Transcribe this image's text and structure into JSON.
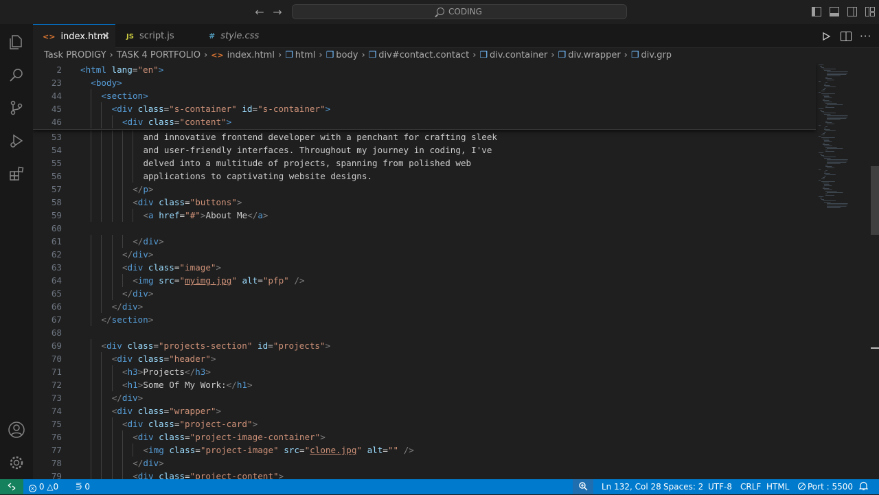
{
  "titlebar": {
    "search_text": "CODING"
  },
  "tabs": [
    {
      "label": "index.html",
      "icon": "html-file-icon",
      "active": true
    },
    {
      "label": "script.js",
      "icon": "js-file-icon",
      "active": false
    },
    {
      "label": "style.css",
      "icon": "css-file-icon",
      "active": false
    }
  ],
  "tab_icons": {
    "html": "<>",
    "js": "JS",
    "css": "#"
  },
  "breadcrumb": [
    "Task PRODIGY",
    "TASK 4 PORTFOLIO",
    "index.html",
    "html",
    "body",
    "div#contact.contact",
    "div.container",
    "div.wrapper",
    "div.grp"
  ],
  "sticky_lines": [
    {
      "n": "2",
      "indent": 0,
      "tokens": [
        [
          "tg",
          "<html "
        ],
        [
          "at",
          "lang"
        ],
        [
          "tx",
          "="
        ],
        [
          "st",
          "\"en\""
        ],
        [
          "tg",
          ">"
        ]
      ]
    },
    {
      "n": "23",
      "indent": 1,
      "tokens": [
        [
          "tg",
          "<body>"
        ]
      ]
    },
    {
      "n": "44",
      "indent": 2,
      "tokens": [
        [
          "tg",
          "<section>"
        ]
      ]
    },
    {
      "n": "45",
      "indent": 3,
      "tokens": [
        [
          "tg",
          "<div "
        ],
        [
          "at",
          "class"
        ],
        [
          "tx",
          "="
        ],
        [
          "st",
          "\"s-container\""
        ],
        [
          "tx",
          " "
        ],
        [
          "at",
          "id"
        ],
        [
          "tx",
          "="
        ],
        [
          "st",
          "\"s-container\""
        ],
        [
          "tg",
          ">"
        ]
      ]
    },
    {
      "n": "46",
      "indent": 4,
      "tokens": [
        [
          "tg",
          "<div "
        ],
        [
          "at",
          "class"
        ],
        [
          "tx",
          "="
        ],
        [
          "st",
          "\"content\""
        ],
        [
          "tg",
          ">"
        ]
      ]
    }
  ],
  "code_lines": [
    {
      "n": "53",
      "indent": 6,
      "tokens": [
        [
          "tx",
          "and innovative frontend developer with a penchant for crafting sleek"
        ]
      ]
    },
    {
      "n": "54",
      "indent": 6,
      "tokens": [
        [
          "tx",
          "and user-friendly interfaces. Throughout my journey in coding, I've"
        ]
      ]
    },
    {
      "n": "55",
      "indent": 6,
      "tokens": [
        [
          "tx",
          "delved into a multitude of projects, spanning from polished web"
        ]
      ]
    },
    {
      "n": "56",
      "indent": 6,
      "tokens": [
        [
          "tx",
          "applications to captivating website designs."
        ]
      ]
    },
    {
      "n": "57",
      "indent": 5,
      "tokens": [
        [
          "br",
          "</"
        ],
        [
          "tg",
          "p"
        ],
        [
          "br",
          ">"
        ]
      ]
    },
    {
      "n": "58",
      "indent": 5,
      "tokens": [
        [
          "br",
          "<"
        ],
        [
          "tg",
          "div "
        ],
        [
          "at",
          "class"
        ],
        [
          "tx",
          "="
        ],
        [
          "st",
          "\"buttons\""
        ],
        [
          "br",
          ">"
        ]
      ]
    },
    {
      "n": "59",
      "indent": 6,
      "tokens": [
        [
          "br",
          "<"
        ],
        [
          "tg",
          "a "
        ],
        [
          "at",
          "href"
        ],
        [
          "tx",
          "="
        ],
        [
          "st",
          "\"#\""
        ],
        [
          "br",
          ">"
        ],
        [
          "tx",
          "About Me"
        ],
        [
          "br",
          "</"
        ],
        [
          "tg",
          "a"
        ],
        [
          "br",
          ">"
        ]
      ]
    },
    {
      "n": "60",
      "indent": 0,
      "tokens": []
    },
    {
      "n": "61",
      "indent": 5,
      "tokens": [
        [
          "br",
          "</"
        ],
        [
          "tg",
          "div"
        ],
        [
          "br",
          ">"
        ]
      ]
    },
    {
      "n": "62",
      "indent": 4,
      "tokens": [
        [
          "br",
          "</"
        ],
        [
          "tg",
          "div"
        ],
        [
          "br",
          ">"
        ]
      ]
    },
    {
      "n": "63",
      "indent": 4,
      "tokens": [
        [
          "br",
          "<"
        ],
        [
          "tg",
          "div "
        ],
        [
          "at",
          "class"
        ],
        [
          "tx",
          "="
        ],
        [
          "st",
          "\"image\""
        ],
        [
          "br",
          ">"
        ]
      ]
    },
    {
      "n": "64",
      "indent": 5,
      "tokens": [
        [
          "br",
          "<"
        ],
        [
          "tg",
          "img "
        ],
        [
          "at",
          "src"
        ],
        [
          "tx",
          "="
        ],
        [
          "st",
          "\""
        ],
        [
          "lk",
          "myimg.jpg"
        ],
        [
          "st",
          "\""
        ],
        [
          "tx",
          " "
        ],
        [
          "at",
          "alt"
        ],
        [
          "tx",
          "="
        ],
        [
          "st",
          "\"pfp\""
        ],
        [
          "tx",
          " "
        ],
        [
          "br",
          "/>"
        ]
      ]
    },
    {
      "n": "65",
      "indent": 4,
      "tokens": [
        [
          "br",
          "</"
        ],
        [
          "tg",
          "div"
        ],
        [
          "br",
          ">"
        ]
      ]
    },
    {
      "n": "66",
      "indent": 3,
      "tokens": [
        [
          "br",
          "</"
        ],
        [
          "tg",
          "div"
        ],
        [
          "br",
          ">"
        ]
      ]
    },
    {
      "n": "67",
      "indent": 2,
      "tokens": [
        [
          "br",
          "</"
        ],
        [
          "tg",
          "section"
        ],
        [
          "br",
          ">"
        ]
      ]
    },
    {
      "n": "68",
      "indent": 0,
      "tokens": []
    },
    {
      "n": "69",
      "indent": 2,
      "tokens": [
        [
          "br",
          "<"
        ],
        [
          "tg",
          "div "
        ],
        [
          "at",
          "class"
        ],
        [
          "tx",
          "="
        ],
        [
          "st",
          "\"projects-section\""
        ],
        [
          "tx",
          " "
        ],
        [
          "at",
          "id"
        ],
        [
          "tx",
          "="
        ],
        [
          "st",
          "\"projects\""
        ],
        [
          "br",
          ">"
        ]
      ]
    },
    {
      "n": "70",
      "indent": 3,
      "tokens": [
        [
          "br",
          "<"
        ],
        [
          "tg",
          "div "
        ],
        [
          "at",
          "class"
        ],
        [
          "tx",
          "="
        ],
        [
          "st",
          "\"header\""
        ],
        [
          "br",
          ">"
        ]
      ]
    },
    {
      "n": "71",
      "indent": 4,
      "tokens": [
        [
          "br",
          "<"
        ],
        [
          "tg",
          "h3"
        ],
        [
          "br",
          ">"
        ],
        [
          "tx",
          "Projects"
        ],
        [
          "br",
          "</"
        ],
        [
          "tg",
          "h3"
        ],
        [
          "br",
          ">"
        ]
      ]
    },
    {
      "n": "72",
      "indent": 4,
      "tokens": [
        [
          "br",
          "<"
        ],
        [
          "tg",
          "h1"
        ],
        [
          "br",
          ">"
        ],
        [
          "tx",
          "Some Of My Work:"
        ],
        [
          "br",
          "</"
        ],
        [
          "tg",
          "h1"
        ],
        [
          "br",
          ">"
        ]
      ]
    },
    {
      "n": "73",
      "indent": 3,
      "tokens": [
        [
          "br",
          "</"
        ],
        [
          "tg",
          "div"
        ],
        [
          "br",
          ">"
        ]
      ]
    },
    {
      "n": "74",
      "indent": 3,
      "tokens": [
        [
          "br",
          "<"
        ],
        [
          "tg",
          "div "
        ],
        [
          "at",
          "class"
        ],
        [
          "tx",
          "="
        ],
        [
          "st",
          "\"wrapper\""
        ],
        [
          "br",
          ">"
        ]
      ]
    },
    {
      "n": "75",
      "indent": 4,
      "tokens": [
        [
          "br",
          "<"
        ],
        [
          "tg",
          "div "
        ],
        [
          "at",
          "class"
        ],
        [
          "tx",
          "="
        ],
        [
          "st",
          "\"project-card\""
        ],
        [
          "br",
          ">"
        ]
      ]
    },
    {
      "n": "76",
      "indent": 5,
      "tokens": [
        [
          "br",
          "<"
        ],
        [
          "tg",
          "div "
        ],
        [
          "at",
          "class"
        ],
        [
          "tx",
          "="
        ],
        [
          "st",
          "\"project-image-container\""
        ],
        [
          "br",
          ">"
        ]
      ]
    },
    {
      "n": "77",
      "indent": 6,
      "tokens": [
        [
          "br",
          "<"
        ],
        [
          "tg",
          "img "
        ],
        [
          "at",
          "class"
        ],
        [
          "tx",
          "="
        ],
        [
          "st",
          "\"project-image\""
        ],
        [
          "tx",
          " "
        ],
        [
          "at",
          "src"
        ],
        [
          "tx",
          "="
        ],
        [
          "st",
          "\""
        ],
        [
          "lk",
          "clone.jpg"
        ],
        [
          "st",
          "\""
        ],
        [
          "tx",
          " "
        ],
        [
          "at",
          "alt"
        ],
        [
          "tx",
          "="
        ],
        [
          "st",
          "\"\""
        ],
        [
          "tx",
          " "
        ],
        [
          "br",
          "/>"
        ]
      ]
    },
    {
      "n": "78",
      "indent": 5,
      "tokens": [
        [
          "br",
          "</"
        ],
        [
          "tg",
          "div"
        ],
        [
          "br",
          ">"
        ]
      ]
    },
    {
      "n": "79",
      "indent": 5,
      "tokens": [
        [
          "br",
          "<"
        ],
        [
          "tg",
          "div "
        ],
        [
          "at",
          "class"
        ],
        [
          "tx",
          "="
        ],
        [
          "st",
          "\"project-content\""
        ],
        [
          "br",
          ">"
        ]
      ]
    }
  ],
  "statusbar": {
    "errors": "0",
    "warnings": "0",
    "ports_count": "0",
    "cursor": "Ln 132, Col 28",
    "spaces": "Spaces: 2",
    "encoding": "UTF-8",
    "eol": "CRLF",
    "language": "HTML",
    "port": "Port : 5500"
  },
  "colors": {
    "accent": "#007acc",
    "remote": "#16825d",
    "tag": "#569cd6",
    "attr": "#9cdcfe",
    "string": "#ce9178"
  }
}
